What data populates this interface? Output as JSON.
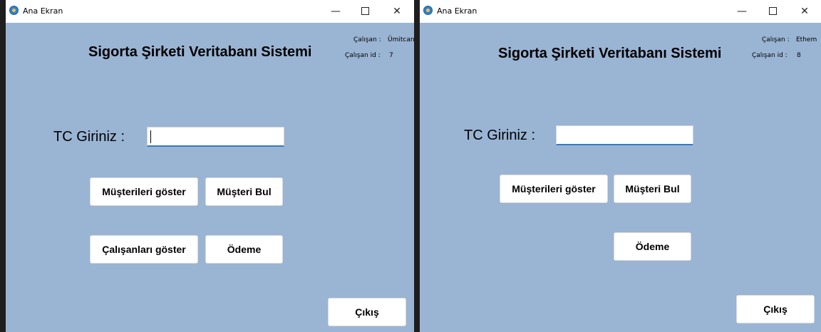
{
  "windows": [
    {
      "title": "Ana Ekran",
      "heading": "Sigorta Şirketi Veritabanı Sistemi",
      "employee_label": "Çalışan :",
      "employee_name": "Ümitcan",
      "employee_id_label": "Çalışan id :",
      "employee_id": "7",
      "tc_label": "TC Giriniz :",
      "tc_value": "",
      "buttons": {
        "show_customers": "Müşterileri göster",
        "find_customer": "Müşteri Bul",
        "show_employees": "Çalışanları göster",
        "payment": "Ödeme",
        "exit": "Çıkış"
      }
    },
    {
      "title": "Ana Ekran",
      "heading": "Sigorta Şirketi Veritabanı Sistemi",
      "employee_label": "Çalışan :",
      "employee_name": "Ethem",
      "employee_id_label": "Çalışan id :",
      "employee_id": "8",
      "tc_label": "TC Giriniz :",
      "tc_value": "",
      "buttons": {
        "show_customers": "Müşterileri göster",
        "find_customer": "Müşteri Bul",
        "payment": "Ödeme",
        "exit": "Çıkış"
      }
    }
  ],
  "window_controls": {
    "minimize": "—",
    "close": "✕"
  },
  "icons": {
    "app": "app-icon",
    "minimize": "minimize-icon",
    "maximize": "maximize-icon",
    "close": "close-icon"
  },
  "colors": {
    "form_background": "#9ab4d3",
    "titlebar": "#ffffff",
    "input_accent": "#3a78c0",
    "desktop": "#1e1e1e"
  }
}
